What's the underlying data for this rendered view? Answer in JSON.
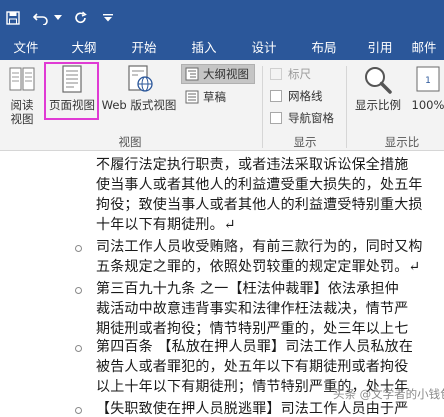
{
  "qat": {
    "icons": [
      "save-icon",
      "undo-icon",
      "undo-dropdown-icon",
      "redo-icon",
      "customize-qat-icon"
    ]
  },
  "tabs": [
    {
      "label": "文件"
    },
    {
      "label": "大纲"
    },
    {
      "label": "开始"
    },
    {
      "label": "插入"
    },
    {
      "label": "设计"
    },
    {
      "label": "布局"
    },
    {
      "label": "引用"
    },
    {
      "label": "邮件"
    }
  ],
  "ribbon": {
    "views": {
      "read_mode": "阅读\n视图",
      "print_layout": "页面视图",
      "web_layout": "Web 版式视图",
      "outline": "大纲视图",
      "draft": "草稿",
      "group_label": "视图"
    },
    "show": {
      "ruler": "标尺",
      "gridlines": "网格线",
      "nav_pane": "导航窗格",
      "group_label": "显示"
    },
    "zoom": {
      "zoom": "显示比例",
      "percent": "100%",
      "group_label": "显示比"
    }
  },
  "document": {
    "lines": [
      "不履行法定执行职责，或者违法采取诉讼保全措施",
      "使当事人或者其他人的利益遭受重大损失的，处五年",
      "拘役；致使当事人或者其他人的利益遭受特别重大损",
      "十年以下有期徒刑。↵",
      "司法工作人员收受贿赂，有前三款行为的，同时又构",
      "五条规定之罪的，依照处罚较重的规定定罪处罚。↵",
      "第三百九十九条 之一【枉法仲裁罪】依法承担仲",
      "裁活动中故意违背事实和法律作枉法裁决，情节严",
      "期徒刑或者拘役；情节特别严重的，处三年以上七",
      "第四百条 【私放在押人员罪】司法工作人员私放在",
      "被告人或者罪犯的，处五年以下有期徒刑或者拘役",
      "以上十年以下有期徒刑；情节特别严重的，处十年",
      "【失职致使在押人员脱逃罪】司法工作人员由于严"
    ],
    "watermark": "头条 @文学者的小钱包"
  }
}
